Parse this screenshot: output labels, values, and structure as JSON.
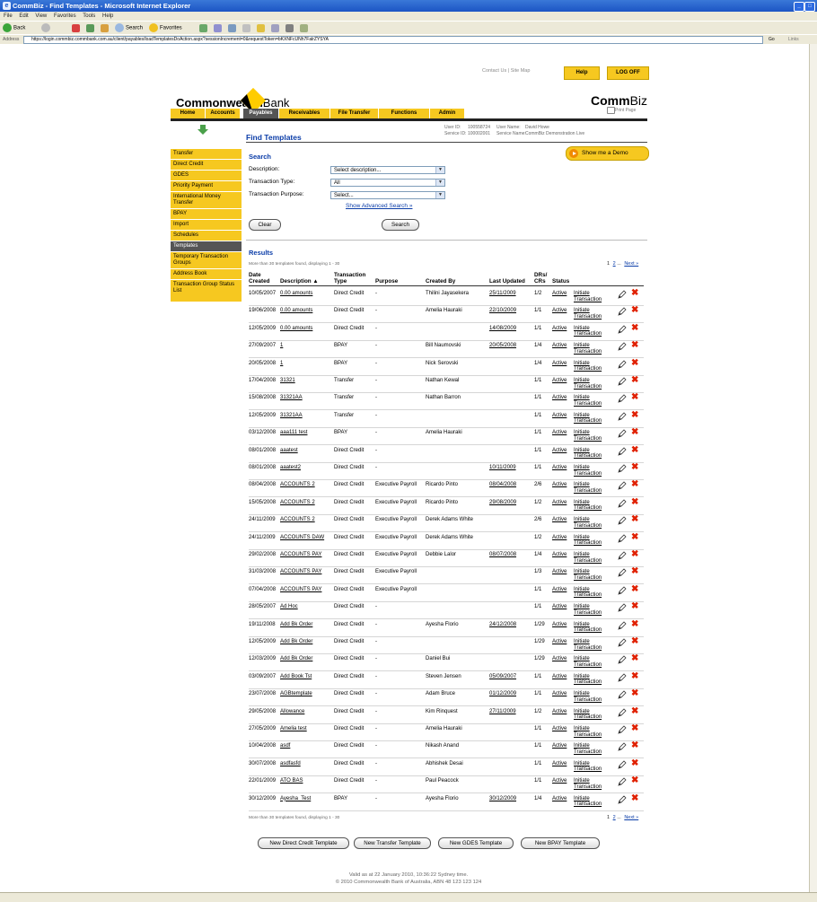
{
  "window": {
    "title": "CommBiz - Find Templates - Microsoft Internet Explorer"
  },
  "menu": [
    "File",
    "Edit",
    "View",
    "Favorites",
    "Tools",
    "Help"
  ],
  "toolbar": {
    "back": "Back",
    "search": "Search",
    "favorites": "Favorites"
  },
  "address": {
    "label": "Address",
    "url": "https://login.commbiz.commbank.com.au/client/payables/loadTemplatesDoAction.aspx?sessionIncrement=0&requestToken=bKXNFcUNh7FalrZYSYA",
    "go": "Go",
    "links": "Links"
  },
  "header": {
    "contact_us": "Contact Us",
    "site_map": "Site Map",
    "help": "Help",
    "log_off": "LOG OFF",
    "brand_bold": "Commonwealth",
    "brand_rest": "Bank",
    "commbiz_bold": "Comm",
    "commbiz_rest": "Biz",
    "print_page": "Print Page"
  },
  "nav": [
    "Home",
    "Accounts",
    "Payables",
    "Receivables",
    "File Transfer",
    "Functions",
    "Admin"
  ],
  "page_title": "Find Templates",
  "user": {
    "user_id_label": "User ID:",
    "user_id": "100558724",
    "user_name_label": "User Name:",
    "user_name": "David Howe",
    "service_id_label": "Service ID:",
    "service_id": "100002001",
    "service_name_label": "Service Name:",
    "service_name": "CommBiz Demonstration Live"
  },
  "sidebar": [
    "Transfer",
    "Direct Credit",
    "GDES",
    "Priority Payment",
    "International Money Transfer",
    "BPAY",
    "Import",
    "Schedules",
    "Templates",
    "Temporary Transaction Groups",
    "Address Book",
    "Transaction Group Status List"
  ],
  "search": {
    "heading": "Search",
    "demo": "Show me a Demo",
    "description_label": "Description:",
    "description_value": "Select description...",
    "type_label": "Transaction Type:",
    "type_value": "All",
    "purpose_label": "Transaction Purpose:",
    "purpose_value": "Select...",
    "advanced": "Show Advanced Search »",
    "clear": "Clear",
    "search": "Search"
  },
  "results": {
    "heading": "Results",
    "info": "More than 30 templates found, displaying 1 - 30",
    "pages": [
      "1",
      "2",
      "...",
      "Next »"
    ],
    "headers": {
      "date": "Date Created",
      "desc": "Description ▲",
      "type": "Transaction Type",
      "purpose": "Purpose",
      "created_by": "Created By",
      "last_updated": "Last Updated",
      "drs": "DRs/ CRs",
      "status": "Status"
    },
    "initiate": "Initiate Transaction",
    "rows": [
      {
        "date": "10/05/2007",
        "desc": "0.00 amounts",
        "type": "Direct Credit",
        "purpose": "-",
        "by": "Thilini Jayasekera",
        "updated": "25/11/2009",
        "dr": "1/2",
        "status": "Active"
      },
      {
        "date": "19/06/2008",
        "desc": "0.00 amounts",
        "type": "Direct Credit",
        "purpose": "-",
        "by": "Amelia Hauraki",
        "updated": "22/10/2009",
        "dr": "1/1",
        "status": "Active"
      },
      {
        "date": "12/05/2009",
        "desc": "0.00 amounts",
        "type": "Direct Credit",
        "purpose": "-",
        "by": "",
        "updated": "14/08/2009",
        "dr": "1/1",
        "status": "Active"
      },
      {
        "date": "27/09/2007",
        "desc": "1",
        "type": "BPAY",
        "purpose": "-",
        "by": "Bill Naumovski",
        "updated": "20/05/2008",
        "dr": "1/4",
        "status": "Active"
      },
      {
        "date": "20/05/2008",
        "desc": "1",
        "type": "BPAY",
        "purpose": "-",
        "by": "Nick Serovski",
        "updated": "",
        "dr": "1/4",
        "status": "Active"
      },
      {
        "date": "17/04/2008",
        "desc": "31321",
        "type": "Transfer",
        "purpose": "-",
        "by": "Nathan Kewal",
        "updated": "",
        "dr": "1/1",
        "status": "Active"
      },
      {
        "date": "15/08/2008",
        "desc": "31321AA",
        "type": "Transfer",
        "purpose": "-",
        "by": "Nathan Barron",
        "updated": "",
        "dr": "1/1",
        "status": "Active"
      },
      {
        "date": "12/05/2009",
        "desc": "31321AA",
        "type": "Transfer",
        "purpose": "-",
        "by": "",
        "updated": "",
        "dr": "1/1",
        "status": "Active"
      },
      {
        "date": "03/12/2008",
        "desc": "aaa111 test",
        "type": "BPAY",
        "purpose": "-",
        "by": "Amelia Hauraki",
        "updated": "",
        "dr": "1/1",
        "status": "Active"
      },
      {
        "date": "08/01/2008",
        "desc": "aaatest",
        "type": "Direct Credit",
        "purpose": "-",
        "by": "",
        "updated": "",
        "dr": "1/1",
        "status": "Active"
      },
      {
        "date": "08/01/2008",
        "desc": "aaatest2",
        "type": "Direct Credit",
        "purpose": "-",
        "by": "",
        "updated": "10/11/2009",
        "dr": "1/1",
        "status": "Active"
      },
      {
        "date": "08/04/2008",
        "desc": "ACCOUNTS 2",
        "type": "Direct Credit",
        "purpose": "Executive Payroll",
        "by": "Ricardo Pinto",
        "updated": "08/04/2008",
        "dr": "2/6",
        "status": "Active"
      },
      {
        "date": "15/05/2008",
        "desc": "ACCOUNTS 2",
        "type": "Direct Credit",
        "purpose": "Executive Payroll",
        "by": "Ricardo Pinto",
        "updated": "29/08/2009",
        "dr": "1/2",
        "status": "Active"
      },
      {
        "date": "24/11/2009",
        "desc": "ACCOUNTS 2",
        "type": "Direct Credit",
        "purpose": "Executive Payroll",
        "by": "Derek Adams White",
        "updated": "",
        "dr": "2/6",
        "status": "Active"
      },
      {
        "date": "24/11/2009",
        "desc": "ACCOUNTS DAW",
        "type": "Direct Credit",
        "purpose": "Executive Payroll",
        "by": "Derek Adams White",
        "updated": "",
        "dr": "1/2",
        "status": "Active"
      },
      {
        "date": "29/02/2008",
        "desc": "ACCOUNTS PAY",
        "type": "Direct Credit",
        "purpose": "Executive Payroll",
        "by": "Debbie Lalor",
        "updated": "08/07/2008",
        "dr": "1/4",
        "status": "Active"
      },
      {
        "date": "31/03/2008",
        "desc": "ACCOUNTS PAY",
        "type": "Direct Credit",
        "purpose": "Executive Payroll",
        "by": "",
        "updated": "",
        "dr": "1/3",
        "status": "Active"
      },
      {
        "date": "07/04/2008",
        "desc": "ACCOUNTS PAY",
        "type": "Direct Credit",
        "purpose": "Executive Payroll",
        "by": "",
        "updated": "",
        "dr": "1/1",
        "status": "Active"
      },
      {
        "date": "28/05/2007",
        "desc": "Ad Hoc",
        "type": "Direct Credit",
        "purpose": "-",
        "by": "",
        "updated": "",
        "dr": "1/1",
        "status": "Active"
      },
      {
        "date": "19/11/2008",
        "desc": "Add Bk Order",
        "type": "Direct Credit",
        "purpose": "-",
        "by": "Ayesha Florio",
        "updated": "24/12/2008",
        "dr": "1/29",
        "status": "Active"
      },
      {
        "date": "12/05/2009",
        "desc": "Add Bk Order",
        "type": "Direct Credit",
        "purpose": "-",
        "by": "",
        "updated": "",
        "dr": "1/29",
        "status": "Active"
      },
      {
        "date": "12/03/2009",
        "desc": "Add Bk Order",
        "type": "Direct Credit",
        "purpose": "-",
        "by": "Daniel Bui",
        "updated": "",
        "dr": "1/29",
        "status": "Active"
      },
      {
        "date": "03/09/2007",
        "desc": "Add Book Tst",
        "type": "Direct Credit",
        "purpose": "-",
        "by": "Steven Jensen",
        "updated": "05/09/2007",
        "dr": "1/1",
        "status": "Active"
      },
      {
        "date": "23/07/2008",
        "desc": "AGBtemplate",
        "type": "Direct Credit",
        "purpose": "-",
        "by": "Adam Bruce",
        "updated": "01/12/2009",
        "dr": "1/1",
        "status": "Active"
      },
      {
        "date": "29/05/2008",
        "desc": "Allowance",
        "type": "Direct Credit",
        "purpose": "-",
        "by": "Kim Rinquest",
        "updated": "27/11/2009",
        "dr": "1/2",
        "status": "Active"
      },
      {
        "date": "27/05/2009",
        "desc": "Amelia test",
        "type": "Direct Credit",
        "purpose": "-",
        "by": "Amelia Hauraki",
        "updated": "",
        "dr": "1/1",
        "status": "Active"
      },
      {
        "date": "10/04/2008",
        "desc": "asdf",
        "type": "Direct Credit",
        "purpose": "-",
        "by": "Nikash Anand",
        "updated": "",
        "dr": "1/1",
        "status": "Active"
      },
      {
        "date": "30/07/2008",
        "desc": "asdfasfd",
        "type": "Direct Credit",
        "purpose": "-",
        "by": "Abhishek Desai",
        "updated": "",
        "dr": "1/1",
        "status": "Active"
      },
      {
        "date": "22/01/2009",
        "desc": "ATO BAS",
        "type": "Direct Credit",
        "purpose": "-",
        "by": "Paul Peacock",
        "updated": "",
        "dr": "1/1",
        "status": "Active"
      },
      {
        "date": "30/12/2009",
        "desc": "Ayesha_Test",
        "type": "BPAY",
        "purpose": "-",
        "by": "Ayesha Florio",
        "updated": "30/12/2009",
        "dr": "1/4",
        "status": "Active"
      }
    ]
  },
  "bottom_buttons": [
    "New Direct Credit Template",
    "New Transfer Template",
    "New GDES Template",
    "New BPAY Template"
  ],
  "footer": {
    "line1": "Valid as at 22 January 2010, 10:36:22 Sydney time.",
    "line2": "© 2010 Commonwealth Bank of Australia, ABN 48 123 123 124"
  },
  "colors": {
    "brand_yellow": "#f6c820",
    "link_blue": "#0b3da8",
    "delete_red": "#e02000",
    "nav_active": "#555555"
  }
}
